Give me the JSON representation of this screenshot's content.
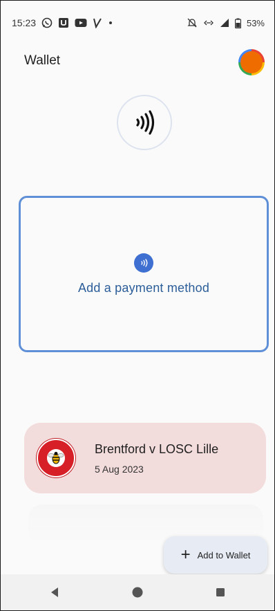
{
  "status_bar": {
    "time": "15:23",
    "battery": "53%",
    "icons": [
      "whatsapp-icon",
      "u-app-icon",
      "youtube-icon",
      "v-app-icon",
      "dot-icon",
      "mute-icon",
      "link-icon",
      "signal-icon",
      "battery-icon"
    ]
  },
  "app": {
    "title": "Wallet",
    "avatar_color": "#ef6c00"
  },
  "payment_card": {
    "label": "Add a payment method",
    "accent": "#5f8fd6"
  },
  "ticket": {
    "title": "Brentford v LOSC Lille",
    "date": "5 Aug 2023",
    "background": "#f3dcdc",
    "crest": "brentford-crest-icon"
  },
  "fab": {
    "label": "Add to Wallet",
    "icon": "plus-icon"
  },
  "nav": {
    "icons": [
      "back-icon",
      "home-icon",
      "recents-icon"
    ]
  }
}
